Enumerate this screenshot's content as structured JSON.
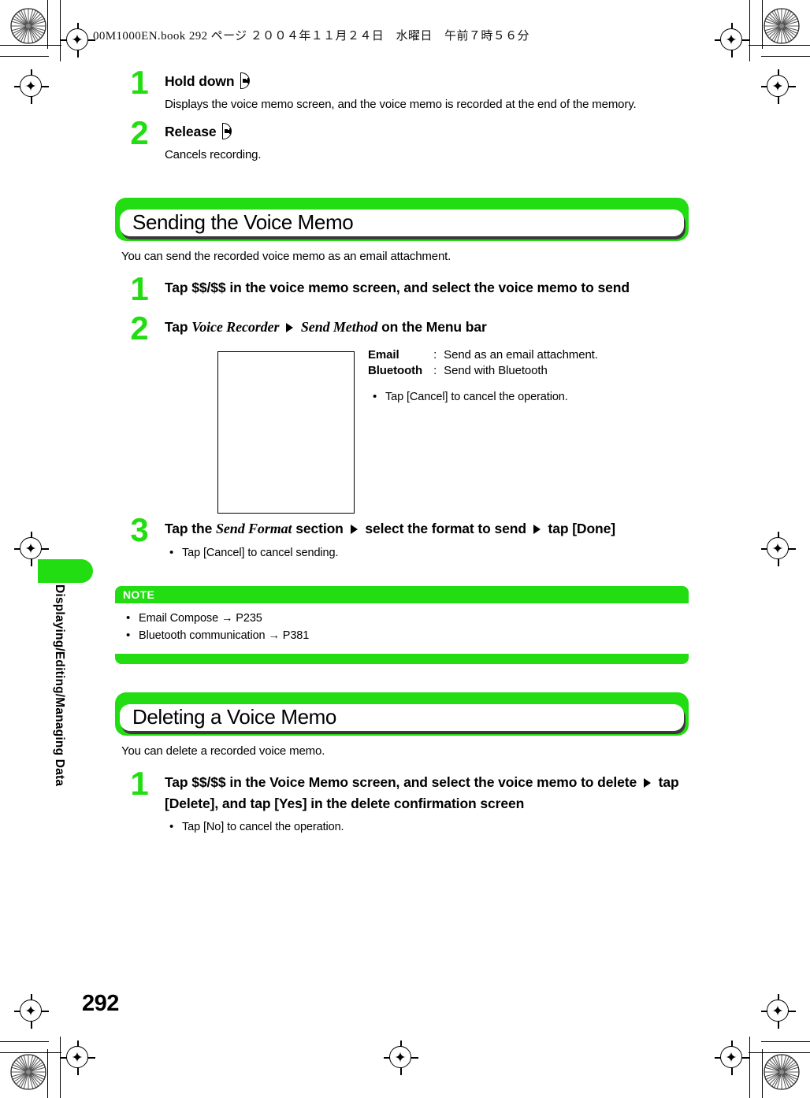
{
  "meta": {
    "book_header": "00M1000EN.book   292 ページ   ２００４年１１月２４日　水曜日　午前７時５６分",
    "page_number": "292",
    "side_tab_label": "Displaying/Editing/Managing Data",
    "accent_green": "#22dd11",
    "text_color": "#000000"
  },
  "top_steps": [
    {
      "number": "1",
      "title_before": "Hold down",
      "icon": "voice-memo-key-icon",
      "desc": "Displays the voice memo screen, and the voice memo is recorded at the end of the memory."
    },
    {
      "number": "2",
      "title_before": "Release",
      "icon": "voice-memo-key-icon",
      "desc": "Cancels recording."
    }
  ],
  "section_sending": {
    "banner_title": "Sending the Voice Memo",
    "lead": "You can send the recorded voice memo as an email attachment.",
    "step1": {
      "number": "1",
      "title": "Tap $$/$$ in the voice memo screen, and select the voice memo to send"
    },
    "step2": {
      "number": "2",
      "title_a": "Tap",
      "menu_1": "Voice Recorder",
      "menu_2": "Send Method",
      "title_b": "on the Menu bar",
      "options": [
        {
          "key": "Email",
          "sep": ":",
          "value": "Send as an email attachment."
        },
        {
          "key": "Bluetooth",
          "sep": ":",
          "value": "Send with Bluetooth"
        }
      ],
      "note_bullet": "Tap [Cancel] to cancel the operation."
    },
    "step3": {
      "number": "3",
      "title_a": "Tap the",
      "menu_1": "Send Format",
      "title_b": "section",
      "title_c": "select the format to send",
      "title_d": "tap [Done]",
      "note_bullet": "Tap [Cancel] to cancel sending."
    }
  },
  "note_box": {
    "header": "NOTE",
    "items": [
      "Email Compose → P235",
      "Bluetooth communication → P381"
    ]
  },
  "section_deleting": {
    "banner_title": "Deleting a Voice Memo",
    "lead": "You can delete a recorded voice memo.",
    "step1": {
      "number": "1",
      "title_a": "Tap $$/$$ in the Voice Memo screen, and select the voice memo to delete",
      "title_b": "tap [Delete], and tap [Yes] in the delete confirmation screen",
      "note_bullet": "Tap [No] to cancel the operation."
    }
  }
}
